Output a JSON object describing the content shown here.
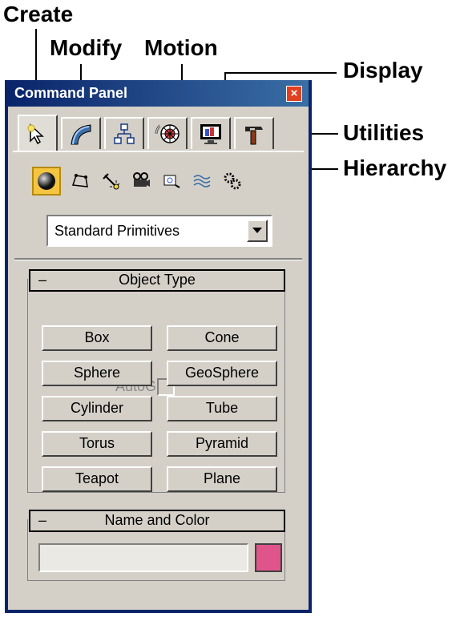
{
  "callouts": {
    "create": "Create",
    "modify": "Modify",
    "motion": "Motion",
    "display": "Display",
    "utilities": "Utilities",
    "hierarchy": "Hierarchy"
  },
  "panel": {
    "title": "Command Panel",
    "close_glyph": "×",
    "tabs": [
      {
        "name": "create",
        "icon": "create-arrow-icon",
        "active": true
      },
      {
        "name": "modify",
        "icon": "modify-curve-icon"
      },
      {
        "name": "hierarchy",
        "icon": "hierarchy-icon"
      },
      {
        "name": "motion",
        "icon": "motion-wheel-icon"
      },
      {
        "name": "display",
        "icon": "display-monitor-icon"
      },
      {
        "name": "utilities",
        "icon": "utilities-hammer-icon"
      }
    ],
    "subcategories": [
      {
        "name": "geometry",
        "icon": "sphere-icon",
        "selected": true
      },
      {
        "name": "shapes",
        "icon": "shapes-icon"
      },
      {
        "name": "lights",
        "icon": "light-icon"
      },
      {
        "name": "cameras",
        "icon": "camera-icon"
      },
      {
        "name": "helpers",
        "icon": "helper-icon"
      },
      {
        "name": "space-warps",
        "icon": "space-warp-icon"
      },
      {
        "name": "systems",
        "icon": "systems-gear-icon"
      }
    ],
    "dropdown": {
      "value": "Standard Primitives"
    },
    "object_type": {
      "collapse": "–",
      "title": "Object Type",
      "autogrid_label": "AutoGrid",
      "autogrid_checked": false,
      "buttons": [
        "Box",
        "Cone",
        "Sphere",
        "GeoSphere",
        "Cylinder",
        "Tube",
        "Torus",
        "Pyramid",
        "Teapot",
        "Plane"
      ]
    },
    "name_and_color": {
      "collapse": "–",
      "title": "Name and Color",
      "name_value": "",
      "color": "#e0548c"
    }
  }
}
